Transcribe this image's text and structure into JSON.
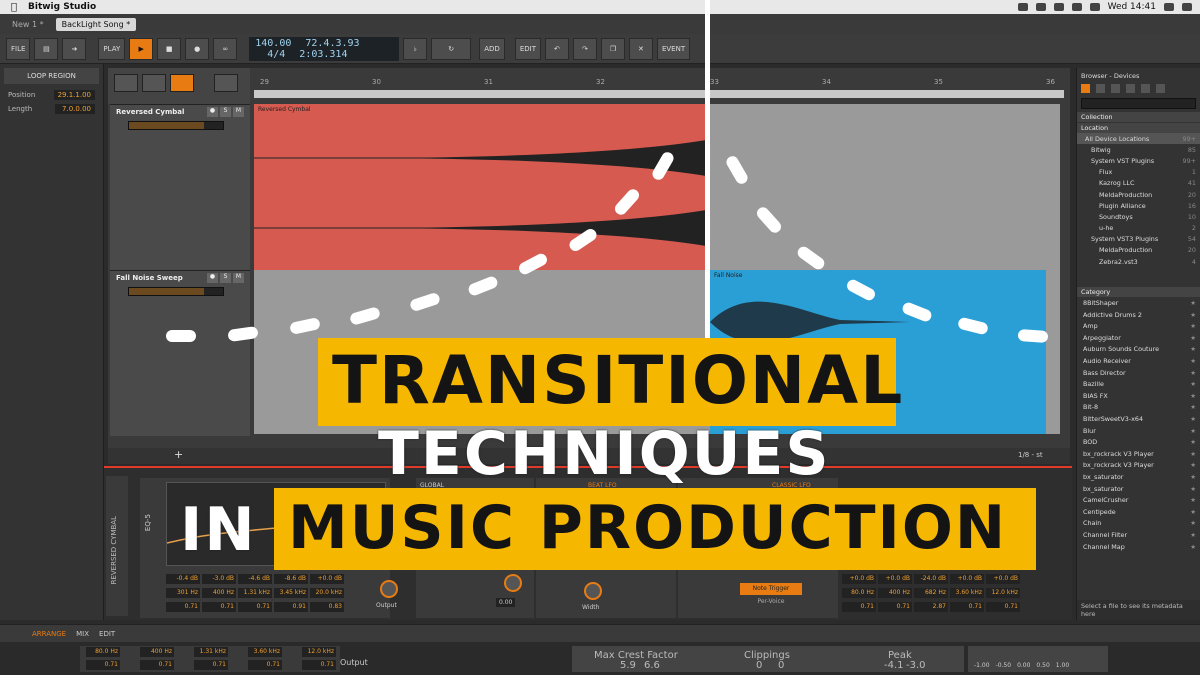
{
  "menubar": {
    "app_name": "Bitwig Studio",
    "clock": "Wed 14:41"
  },
  "doc_tabs": [
    {
      "label": "New 1 *"
    },
    {
      "label": "BackLight Song *"
    }
  ],
  "transport": {
    "file": "FILE",
    "play": "PLAY",
    "add": "ADD",
    "edit": "EDIT",
    "event": "EVENT",
    "tempo": "140.00",
    "time_sig": "4/4",
    "position_beats": "72.4.3.93",
    "position_time": "2:03.314"
  },
  "loop_region": {
    "title": "LOOP REGION",
    "position_label": "Position",
    "position_value": "29.1.1.00",
    "length_label": "Length",
    "length_value": "7.0.0.00"
  },
  "ruler": {
    "ticks": [
      "29",
      "30",
      "31",
      "32",
      "33",
      "34",
      "35",
      "36"
    ]
  },
  "tracks": [
    {
      "name": "Reversed Cymbal",
      "clip_label": "Reversed Cymbal"
    },
    {
      "name": "Fall Noise Sweep",
      "clip_label": "Fall Noise"
    }
  ],
  "arranger_footer": {
    "grid": "1/8 - st"
  },
  "device_panel": {
    "track_name": "REVERSED CYMBAL",
    "eq_name": "EQ-5",
    "global": "GLOBAL",
    "beat_lfo": "BEAT LFO",
    "classic_lfo": "CLASSIC LFO",
    "gains": [
      "-0.4 dB",
      "-3.0 dB",
      "-4.6 dB",
      "-8.6 dB",
      "+0.0 dB"
    ],
    "freqs": [
      "301 Hz",
      "400 Hz",
      "1.31 kHz",
      "3.45 kHz",
      "20.0 kHz"
    ],
    "qs": [
      "0.71",
      "0.71",
      "0.71",
      "0.91",
      "0.83"
    ],
    "output": "Output",
    "width": "Width",
    "amount": "0.00",
    "note_trigger": "Note Trigger",
    "per_voice": "Per-Voice",
    "gains2": [
      "+0.0 dB",
      "+0.0 dB",
      "-24.0 dB",
      "+0.0 dB",
      "+0.0 dB"
    ],
    "freqs2": [
      "80.0 Hz",
      "400 Hz",
      "682 Hz",
      "3.60 kHz",
      "12.0 kHz"
    ],
    "qs2": [
      "0.71",
      "0.71",
      "2.87",
      "0.71",
      "0.71"
    ]
  },
  "browser": {
    "title": "Browser - Devices",
    "collection": "Collection",
    "location": "Location",
    "locations": [
      {
        "label": "All Device Locations",
        "count": "99+",
        "level": 0,
        "selected": true
      },
      {
        "label": "Bitwig",
        "count": "85",
        "level": 1
      },
      {
        "label": "System VST Plugins",
        "count": "99+",
        "level": 1
      },
      {
        "label": "Flux",
        "count": "1",
        "level": 2
      },
      {
        "label": "Kazrog LLC",
        "count": "41",
        "level": 2
      },
      {
        "label": "MeldaProduction",
        "count": "20",
        "level": 2
      },
      {
        "label": "Plugin Alliance",
        "count": "16",
        "level": 2
      },
      {
        "label": "Soundtoys",
        "count": "10",
        "level": 2
      },
      {
        "label": "u-he",
        "count": "2",
        "level": 2
      },
      {
        "label": "System VST3 Plugins",
        "count": "54",
        "level": 1
      },
      {
        "label": "MeldaProduction",
        "count": "20",
        "level": 2
      },
      {
        "label": "Zebra2.vst3",
        "count": "4",
        "level": 2
      }
    ],
    "category": "Category",
    "categories": [
      "8BitShaper",
      "Addictive Drums 2",
      "Amp",
      "Arpeggiator",
      "Auburn Sounds Couture",
      "Audio Receiver",
      "Bass Director",
      "Bazille",
      "BIAS FX",
      "Bit-8",
      "BitterSweetV3-x64",
      "Blur",
      "BOD",
      "bx_rockrack V3 Player",
      "bx_rockrack V3 Player",
      "bx_saturator",
      "bx_saturator",
      "CamelCrusher",
      "Centipede",
      "Chain",
      "Channel Filter",
      "Channel Map"
    ],
    "footer": "Select a file to see its metadata here"
  },
  "bottombar": {
    "arrange": "ARRANGE",
    "mix": "MIX",
    "edit": "EDIT"
  },
  "mixstrip": {
    "freqs": [
      "80.0 Hz",
      "400 Hz",
      "1.31 kHz",
      "3.60 kHz",
      "12.0 kHz"
    ],
    "qs": [
      "0.71",
      "0.71",
      "0.71",
      "0.71",
      "0.71"
    ],
    "output": "Output",
    "max_crest_label": "Max Crest Factor",
    "max_crest_l": "5.9",
    "max_crest_r": "6.6",
    "clippings_label": "Clippings",
    "clip_l": "0",
    "clip_r": "0",
    "peak_label": "Peak",
    "peak_l": "-4.1",
    "peak_r": "-3.0",
    "scale": [
      "-1.00",
      "-0.50",
      "0.00",
      "0.50",
      "1.00"
    ]
  },
  "title_overlay": {
    "line1": "TRANSITIONAL",
    "line2": "TECHNIQUES",
    "line3a": "IN",
    "line3b": "MUSIC PRODUCTION"
  },
  "colors": {
    "accent": "#e87c12",
    "clip_red": "#d65a4f",
    "clip_blue": "#2a9fd6",
    "banner": "#f6b700"
  }
}
